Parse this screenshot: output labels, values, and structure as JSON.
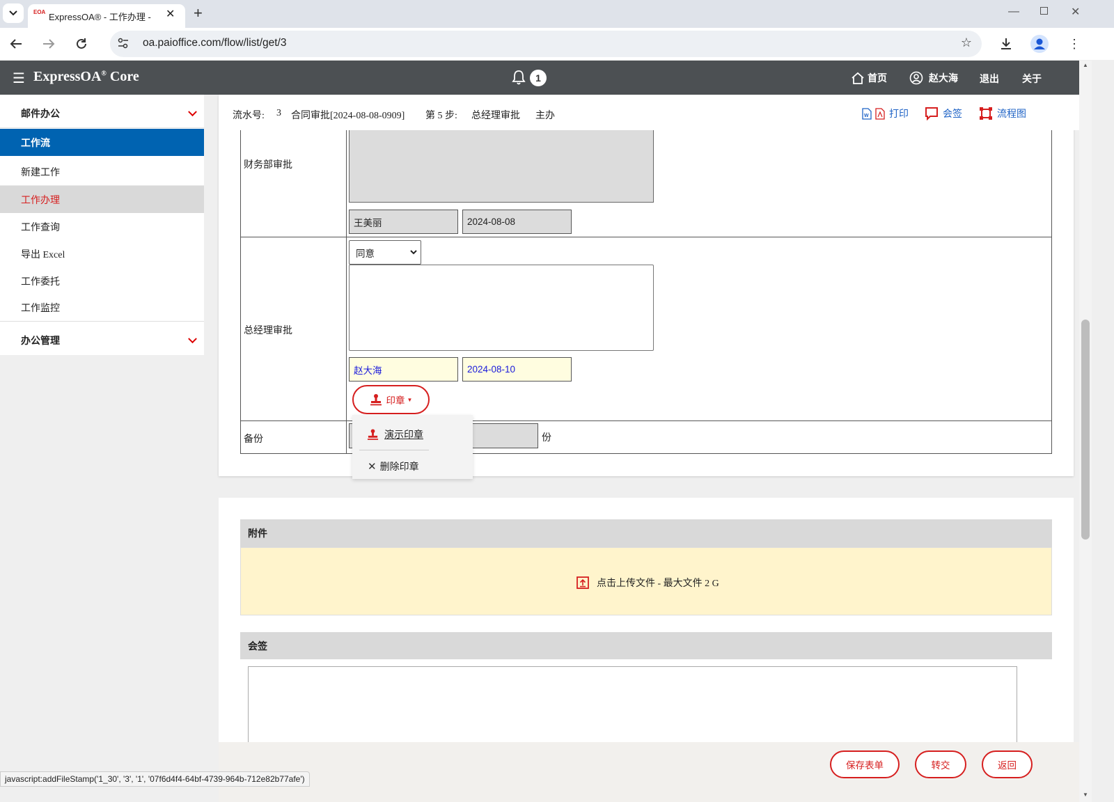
{
  "browser": {
    "tab_title": "ExpressOA® - 工作办理 -",
    "tab_favicon": "EOA",
    "url": "oa.paioffice.com/flow/list/get/3",
    "status_link": "javascript:addFileStamp('1_30', '3', '1', '07f6d4f4-64bf-4739-964b-712e82b77afe')"
  },
  "app": {
    "title": "ExpressOA",
    "title_suffix": " Core",
    "notification_count": "1",
    "nav": {
      "home": "首页",
      "user": "赵大海",
      "logout": "退出",
      "about": "关于"
    }
  },
  "sidebar": {
    "group_mail": "邮件办公",
    "group_workflow": "工作流",
    "items": [
      "新建工作",
      "工作办理",
      "工作查询",
      "导出 Excel",
      "工作委托",
      "工作监控"
    ],
    "active_item": "工作办理",
    "group_office": "办公管理"
  },
  "info": {
    "serial_label": "流水号:",
    "serial_value": "3",
    "flow_name": "合同审批[2024-08-08-0909]",
    "step_label": "第 5 步:",
    "step_name": "总经理审批",
    "role": "主办",
    "print": "打印",
    "countersign": "会签",
    "flowchart": "流程图"
  },
  "form": {
    "finance_label": "财务部审批",
    "finance_signer": "王美丽",
    "finance_date": "2024-08-08",
    "gm_label": "总经理审批",
    "gm_select": "同意",
    "gm_signer": "赵大海",
    "gm_date": "2024-08-10",
    "stamp_button": "印章",
    "backup_label": "备份",
    "backup_unit": "份"
  },
  "stamp_menu": {
    "demo_stamp": "演示印章",
    "delete_stamp": "删除印章"
  },
  "attachments": {
    "header": "附件",
    "upload_text": "点击上传文件 - 最大文件 2 G"
  },
  "countersign": {
    "header": "会签"
  },
  "footer": {
    "save": "保存表单",
    "transfer": "转交",
    "back": "返回"
  },
  "colors": {
    "accent_red": "#d61f1f",
    "active_blue": "#0063b1",
    "header_dark": "#4c5053"
  }
}
